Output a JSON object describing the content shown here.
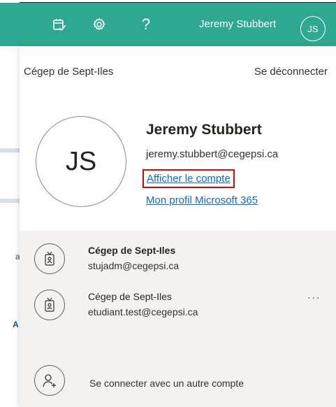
{
  "topbar": {
    "icons": [
      "task-check-icon",
      "gear-icon",
      "help-icon"
    ],
    "help_glyph": "?",
    "user_name": "Jeremy Stubbert",
    "user_initials": "JS",
    "bg_color": "#2ea890"
  },
  "flyout": {
    "organization": "Cégep de Sept-Iles",
    "sign_out": "Se déconnecter",
    "avatar_initials": "JS",
    "name": "Jeremy Stubbert",
    "email": "jeremy.stubbert@cegepsi.ca",
    "view_account": "Afficher le compte",
    "m365_profile": "Mon profil Microsoft 365"
  },
  "accounts": [
    {
      "org": "Cégep de Sept-Iles",
      "email": "stujadm@cegepsi.ca",
      "active": true
    },
    {
      "org": "Cégep de Sept-Iles",
      "email": "etudiant.test@cegepsi.ca",
      "active": false
    }
  ],
  "more_glyph": "...",
  "add_account": "Se connecter avec un autre compte",
  "background_fragments": [
    "a",
    "A"
  ],
  "colors": {
    "link": "#0f6cbd",
    "highlight_box": "#e00000",
    "accounts_bg": "#f3f2f1"
  }
}
